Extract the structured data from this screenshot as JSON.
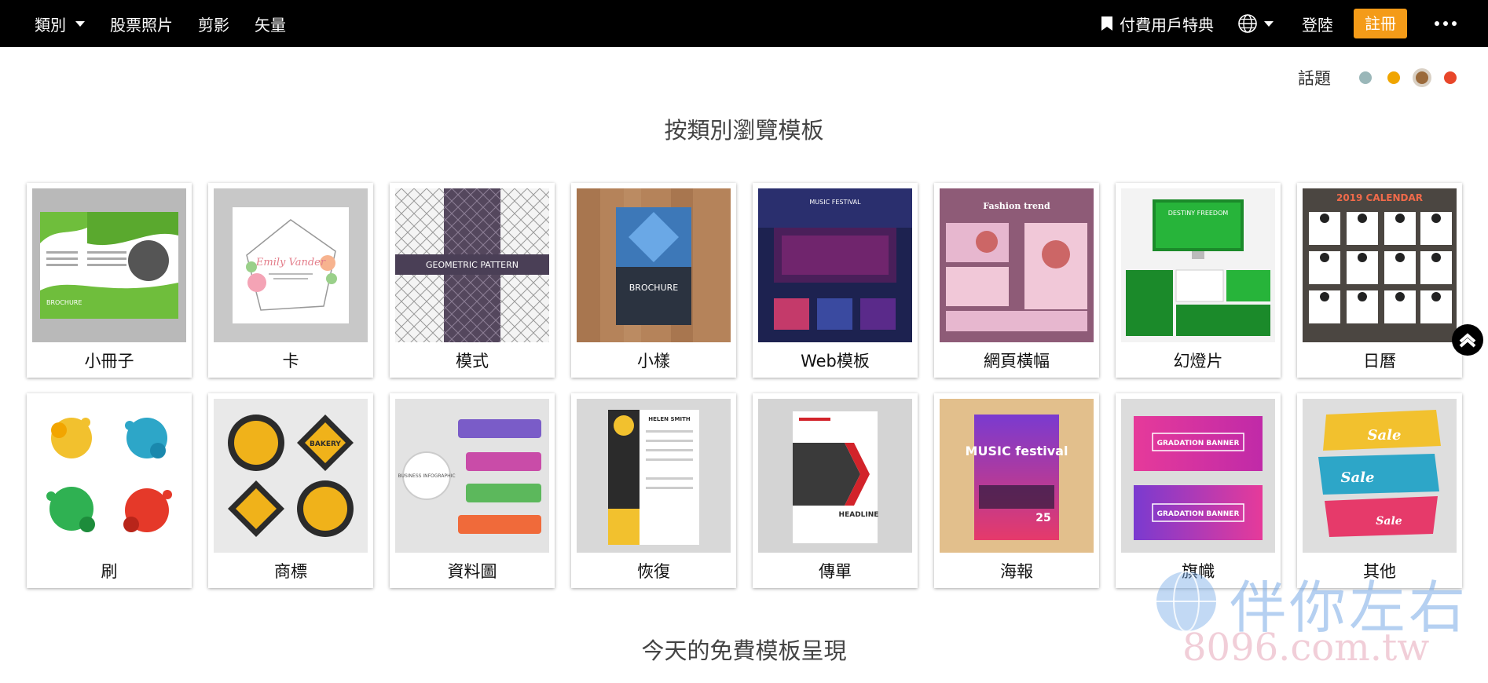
{
  "topbar": {
    "categories_label": "類別",
    "links": [
      "股票照片",
      "剪影",
      "矢量"
    ],
    "premium_label": "付費用戶特典",
    "login_label": "登陸",
    "register_label": "註冊"
  },
  "theme": {
    "label": "話題",
    "swatches": [
      "#9ab7b9",
      "#f0a500",
      "#9b6a3b",
      "#e8462a"
    ],
    "active_index": 2
  },
  "browse_title": "按類別瀏覽模板",
  "categories": [
    {
      "label": "小冊子",
      "thumb_text": "BROCHURE"
    },
    {
      "label": "卡",
      "thumb_text": "Emily Vander"
    },
    {
      "label": "模式",
      "thumb_text": "GEOMETRIC PATTERN"
    },
    {
      "label": "小樣",
      "thumb_text": "BROCHURE"
    },
    {
      "label": "Web模板",
      "thumb_text": "MUSIC FESTIVAL"
    },
    {
      "label": "網頁橫幅",
      "thumb_text": "Fashion trend"
    },
    {
      "label": "幻燈片",
      "thumb_text": "DESTINY FREEDOM"
    },
    {
      "label": "日曆",
      "thumb_text": "2019 CALENDAR"
    },
    {
      "label": "刷",
      "thumb_text": ""
    },
    {
      "label": "商標",
      "thumb_text": "BAKERY"
    },
    {
      "label": "資料圖",
      "thumb_text": "BUSINESS INFOGRAPHIC"
    },
    {
      "label": "恢復",
      "thumb_text": "HELEN SMITH"
    },
    {
      "label": "傳單",
      "thumb_text": "HEADLINE"
    },
    {
      "label": "海報",
      "thumb_text": "MUSIC festival"
    },
    {
      "label": "旗幟",
      "thumb_text": "GRADATION BANNER"
    },
    {
      "label": "其他",
      "thumb_text": "Sale"
    }
  ],
  "free_title": "今天的免費模板呈現",
  "watermark": {
    "line1": "伴你左右",
    "line2": "8096.com.tw"
  },
  "colors": {
    "accent": "#f49b18",
    "topbar_bg": "#000000"
  }
}
